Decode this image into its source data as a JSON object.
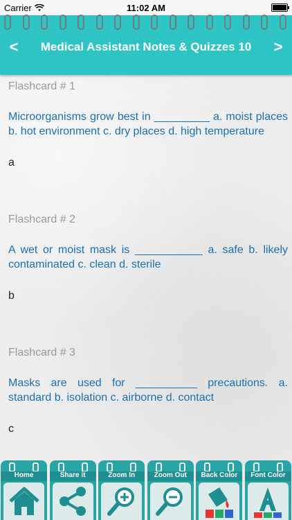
{
  "status_bar": {
    "carrier": "Carrier",
    "time": "11:02 AM"
  },
  "header": {
    "title": "Medical Assistant Notes & Quizzes 10",
    "prev_symbol": "<",
    "next_symbol": ">"
  },
  "flashcards": [
    {
      "label": "Flashcard # 1",
      "question": "Microorganisms grow best in _________ a. moist places b. hot environment c. dry places d. high temperature",
      "answer": "a"
    },
    {
      "label": "Flashcard # 2",
      "question": "A wet or moist mask is ___________ a. safe b. likely contaminated c. clean d. sterile",
      "answer": "b"
    },
    {
      "label": "Flashcard # 3",
      "question": "Masks are used for __________ precautions. a. standard b. isolation c. airborne d. contact",
      "answer": "c"
    }
  ],
  "toolbar": {
    "home": "Home",
    "share": "Share it",
    "zoom_in": "Zoom In",
    "zoom_out": "Zoom Out",
    "back_color": "Back Color",
    "font_color": "Font Color"
  },
  "colors": {
    "header": "#2ec4c4",
    "question_text": "#1a6fb3",
    "label_text": "#9a9a9a"
  }
}
